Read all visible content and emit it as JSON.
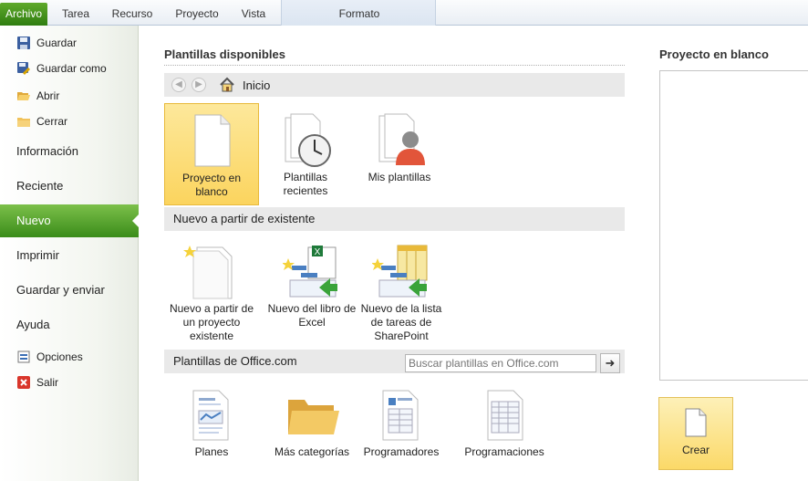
{
  "ribbon": {
    "tabs": [
      "Archivo",
      "Tarea",
      "Recurso",
      "Proyecto",
      "Vista"
    ],
    "contextual_tab": "Formato",
    "active_tab_color": "#3a8c1a"
  },
  "sidebar": {
    "items": [
      {
        "label": "Guardar",
        "icon": "save-icon"
      },
      {
        "label": "Guardar como",
        "icon": "save-as-icon"
      },
      {
        "label": "Abrir",
        "icon": "open-folder-icon"
      },
      {
        "label": "Cerrar",
        "icon": "close-folder-icon"
      },
      {
        "label": "Información"
      },
      {
        "label": "Reciente"
      },
      {
        "label": "Nuevo",
        "active": true
      },
      {
        "label": "Imprimir"
      },
      {
        "label": "Guardar y enviar"
      },
      {
        "label": "Ayuda"
      },
      {
        "label": "Opciones",
        "icon": "options-icon"
      },
      {
        "label": "Salir",
        "icon": "exit-icon"
      }
    ]
  },
  "main": {
    "heading": "Plantillas disponibles",
    "breadcrumb": "Inicio",
    "top_tiles": [
      {
        "label": "Proyecto en blanco",
        "icon": "blank-document-icon",
        "selected": true
      },
      {
        "label": "Plantillas recientes",
        "icon": "recent-templates-icon"
      },
      {
        "label": "Mis plantillas",
        "icon": "my-templates-icon"
      }
    ],
    "section_existing": "Nuevo a partir de existente",
    "existing_tiles": [
      {
        "label": "Nuevo a partir de un proyecto existente",
        "icon": "new-from-existing-icon"
      },
      {
        "label": "Nuevo del libro de Excel",
        "icon": "excel-workbook-icon"
      },
      {
        "label": "Nuevo de la lista de tareas de SharePoint",
        "icon": "sharepoint-list-icon"
      }
    ],
    "section_office": "Plantillas de Office.com",
    "search_placeholder": "Buscar plantillas en Office.com",
    "office_tiles": [
      {
        "label": "Planes",
        "icon": "plans-document-icon"
      },
      {
        "label": "Más categorías",
        "icon": "folder-icon"
      },
      {
        "label": "Programadores",
        "icon": "schedulers-icon"
      },
      {
        "label": "Programaciones",
        "icon": "schedules-icon"
      }
    ]
  },
  "preview": {
    "title": "Proyecto en blanco",
    "create_label": "Crear"
  }
}
